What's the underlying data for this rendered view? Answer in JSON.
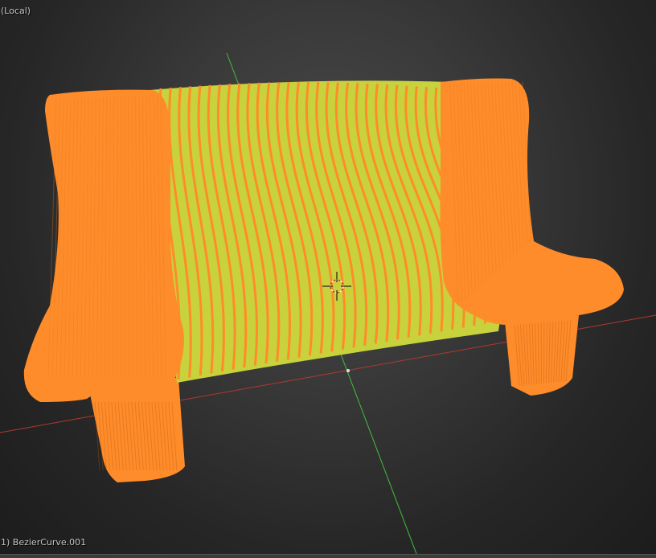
{
  "viewport": {
    "view_label": "(Local)",
    "object_label": "1) BezierCurve.001"
  },
  "colors": {
    "mesh_orange": "#ff8c2a",
    "mesh_yellow": "#c8d23c",
    "axis_x": "#c0392b",
    "axis_y": "#3fbf3f"
  }
}
